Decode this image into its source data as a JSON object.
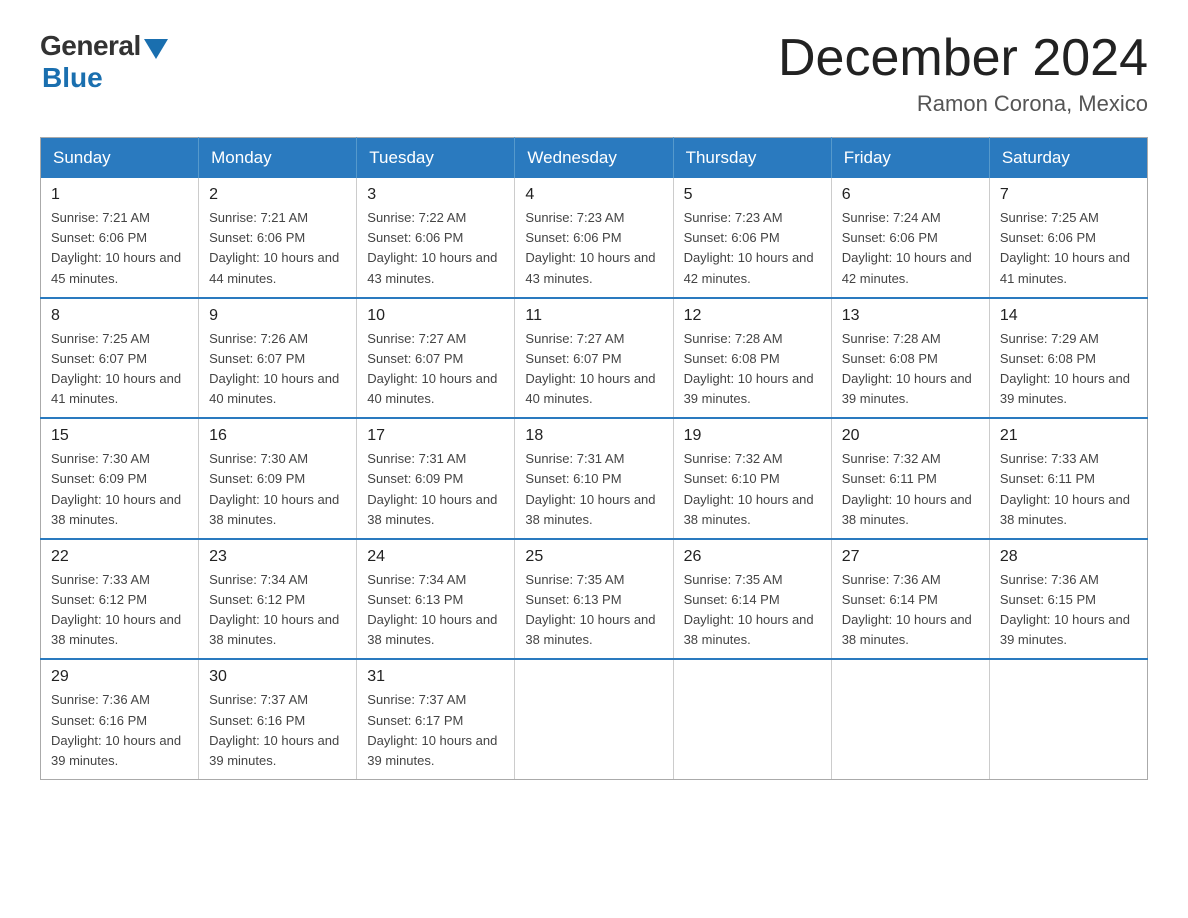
{
  "header": {
    "logo_general": "General",
    "logo_blue": "Blue",
    "month_title": "December 2024",
    "location": "Ramon Corona, Mexico"
  },
  "days_of_week": [
    "Sunday",
    "Monday",
    "Tuesday",
    "Wednesday",
    "Thursday",
    "Friday",
    "Saturday"
  ],
  "weeks": [
    [
      {
        "day": "1",
        "sunrise": "7:21 AM",
        "sunset": "6:06 PM",
        "daylight": "10 hours and 45 minutes."
      },
      {
        "day": "2",
        "sunrise": "7:21 AM",
        "sunset": "6:06 PM",
        "daylight": "10 hours and 44 minutes."
      },
      {
        "day": "3",
        "sunrise": "7:22 AM",
        "sunset": "6:06 PM",
        "daylight": "10 hours and 43 minutes."
      },
      {
        "day": "4",
        "sunrise": "7:23 AM",
        "sunset": "6:06 PM",
        "daylight": "10 hours and 43 minutes."
      },
      {
        "day": "5",
        "sunrise": "7:23 AM",
        "sunset": "6:06 PM",
        "daylight": "10 hours and 42 minutes."
      },
      {
        "day": "6",
        "sunrise": "7:24 AM",
        "sunset": "6:06 PM",
        "daylight": "10 hours and 42 minutes."
      },
      {
        "day": "7",
        "sunrise": "7:25 AM",
        "sunset": "6:06 PM",
        "daylight": "10 hours and 41 minutes."
      }
    ],
    [
      {
        "day": "8",
        "sunrise": "7:25 AM",
        "sunset": "6:07 PM",
        "daylight": "10 hours and 41 minutes."
      },
      {
        "day": "9",
        "sunrise": "7:26 AM",
        "sunset": "6:07 PM",
        "daylight": "10 hours and 40 minutes."
      },
      {
        "day": "10",
        "sunrise": "7:27 AM",
        "sunset": "6:07 PM",
        "daylight": "10 hours and 40 minutes."
      },
      {
        "day": "11",
        "sunrise": "7:27 AM",
        "sunset": "6:07 PM",
        "daylight": "10 hours and 40 minutes."
      },
      {
        "day": "12",
        "sunrise": "7:28 AM",
        "sunset": "6:08 PM",
        "daylight": "10 hours and 39 minutes."
      },
      {
        "day": "13",
        "sunrise": "7:28 AM",
        "sunset": "6:08 PM",
        "daylight": "10 hours and 39 minutes."
      },
      {
        "day": "14",
        "sunrise": "7:29 AM",
        "sunset": "6:08 PM",
        "daylight": "10 hours and 39 minutes."
      }
    ],
    [
      {
        "day": "15",
        "sunrise": "7:30 AM",
        "sunset": "6:09 PM",
        "daylight": "10 hours and 38 minutes."
      },
      {
        "day": "16",
        "sunrise": "7:30 AM",
        "sunset": "6:09 PM",
        "daylight": "10 hours and 38 minutes."
      },
      {
        "day": "17",
        "sunrise": "7:31 AM",
        "sunset": "6:09 PM",
        "daylight": "10 hours and 38 minutes."
      },
      {
        "day": "18",
        "sunrise": "7:31 AM",
        "sunset": "6:10 PM",
        "daylight": "10 hours and 38 minutes."
      },
      {
        "day": "19",
        "sunrise": "7:32 AM",
        "sunset": "6:10 PM",
        "daylight": "10 hours and 38 minutes."
      },
      {
        "day": "20",
        "sunrise": "7:32 AM",
        "sunset": "6:11 PM",
        "daylight": "10 hours and 38 minutes."
      },
      {
        "day": "21",
        "sunrise": "7:33 AM",
        "sunset": "6:11 PM",
        "daylight": "10 hours and 38 minutes."
      }
    ],
    [
      {
        "day": "22",
        "sunrise": "7:33 AM",
        "sunset": "6:12 PM",
        "daylight": "10 hours and 38 minutes."
      },
      {
        "day": "23",
        "sunrise": "7:34 AM",
        "sunset": "6:12 PM",
        "daylight": "10 hours and 38 minutes."
      },
      {
        "day": "24",
        "sunrise": "7:34 AM",
        "sunset": "6:13 PM",
        "daylight": "10 hours and 38 minutes."
      },
      {
        "day": "25",
        "sunrise": "7:35 AM",
        "sunset": "6:13 PM",
        "daylight": "10 hours and 38 minutes."
      },
      {
        "day": "26",
        "sunrise": "7:35 AM",
        "sunset": "6:14 PM",
        "daylight": "10 hours and 38 minutes."
      },
      {
        "day": "27",
        "sunrise": "7:36 AM",
        "sunset": "6:14 PM",
        "daylight": "10 hours and 38 minutes."
      },
      {
        "day": "28",
        "sunrise": "7:36 AM",
        "sunset": "6:15 PM",
        "daylight": "10 hours and 39 minutes."
      }
    ],
    [
      {
        "day": "29",
        "sunrise": "7:36 AM",
        "sunset": "6:16 PM",
        "daylight": "10 hours and 39 minutes."
      },
      {
        "day": "30",
        "sunrise": "7:37 AM",
        "sunset": "6:16 PM",
        "daylight": "10 hours and 39 minutes."
      },
      {
        "day": "31",
        "sunrise": "7:37 AM",
        "sunset": "6:17 PM",
        "daylight": "10 hours and 39 minutes."
      },
      null,
      null,
      null,
      null
    ]
  ]
}
